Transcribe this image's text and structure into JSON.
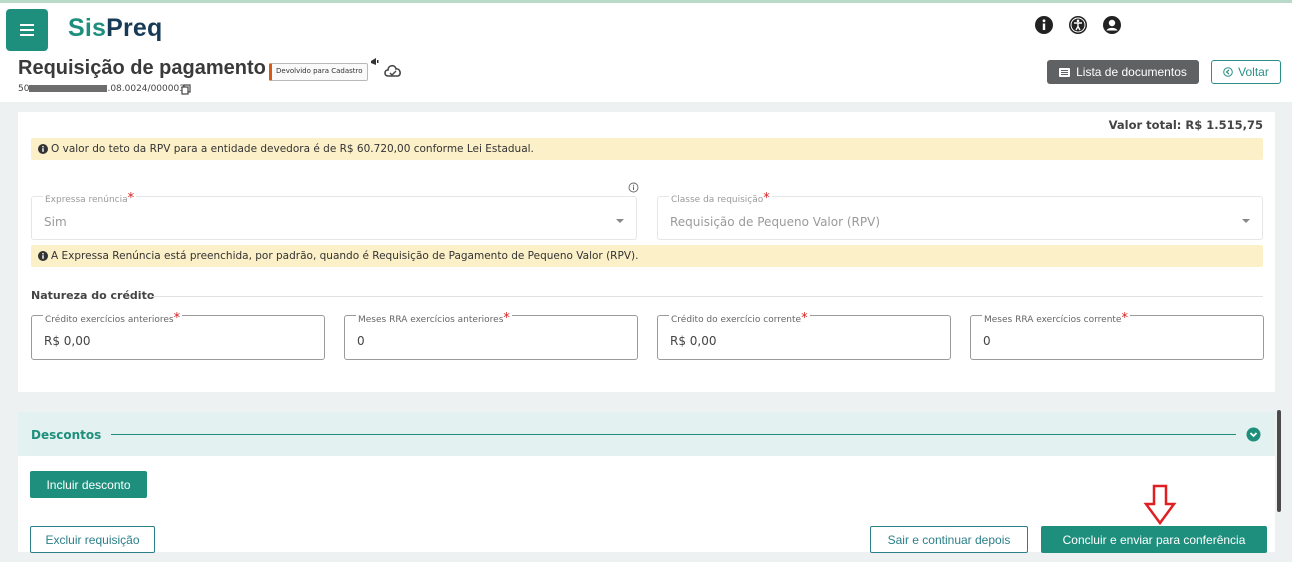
{
  "app": {
    "logo_part1": "Sis",
    "logo_part2": "Preq"
  },
  "header": {
    "title": "Requisição de pagamento",
    "status_badge": "Devolvido para Cadastro",
    "process_number_prefix": "50",
    "process_number_suffix": ".08.0024/000003",
    "docs_button": "Lista de documentos",
    "back_button": "Voltar"
  },
  "summary": {
    "total_label": "Valor total:",
    "total_value": "R$ 1.515,75"
  },
  "alerts": {
    "teto": "O valor do teto da RPV para a entidade devedora é de R$ 60.720,00 conforme Lei Estadual.",
    "renuncia": "A Expressa Renúncia está preenchida, por padrão, quando é Requisição de Pagamento de Pequeno Valor (RPV)."
  },
  "form": {
    "expressa_renuncia": {
      "label": "Expressa renúncia",
      "value": "Sim"
    },
    "classe_requisicao": {
      "label": "Classe da requisição",
      "value": "Requisição de Pequeno Valor (RPV)"
    }
  },
  "natureza": {
    "title": "Natureza do crédito",
    "fields": [
      {
        "label": "Crédito exercícios anteriores",
        "value": "R$ 0,00"
      },
      {
        "label": "Meses RRA exercícios anteriores",
        "value": "0"
      },
      {
        "label": "Crédito do exercício corrente",
        "value": "R$ 0,00"
      },
      {
        "label": "Meses RRA exercícios corrente",
        "value": "0"
      }
    ]
  },
  "descontos": {
    "title": "Descontos",
    "add_button": "Incluir desconto"
  },
  "actions": {
    "delete": "Excluir requisição",
    "save_exit": "Sair e continuar depois",
    "submit": "Concluir e enviar para conferência"
  },
  "colors": {
    "primary": "#1f8f7d",
    "warning_bg": "#fcf0c9",
    "required": "#d62020",
    "annotation": "#e02020"
  },
  "icons": {
    "menu": "hamburger-icon",
    "info": "info-icon",
    "accessibility": "accessibility-icon",
    "user": "user-icon",
    "cloud": "cloud-icon",
    "copy": "copy-icon",
    "chevron": "chevron-down-icon"
  }
}
